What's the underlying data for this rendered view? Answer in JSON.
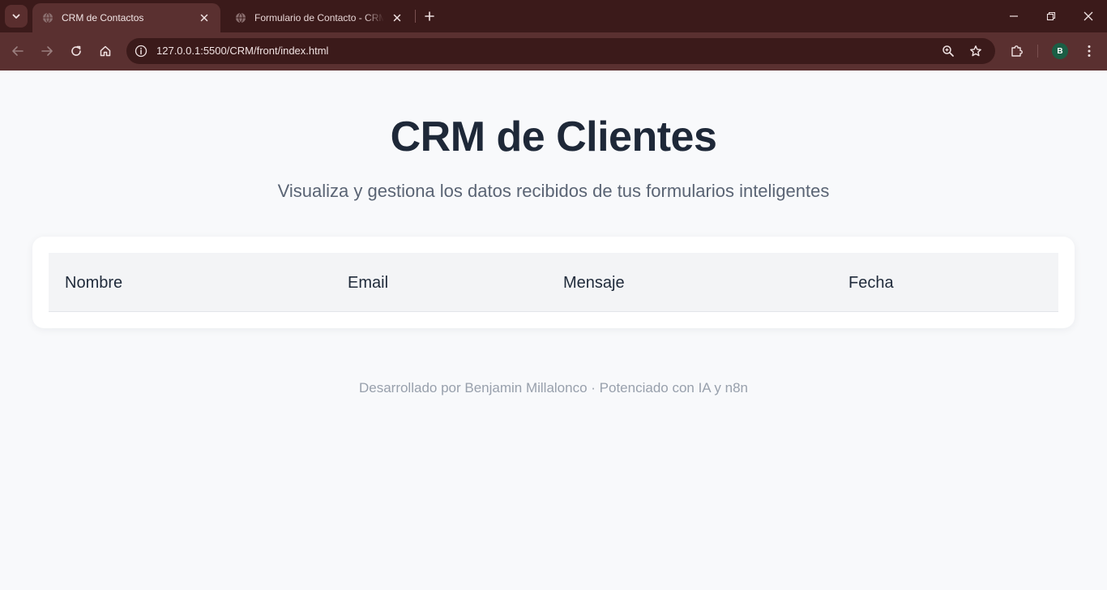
{
  "browser": {
    "tabs": [
      {
        "title": "CRM de Contactos",
        "active": true
      },
      {
        "title": "Formulario de Contacto - CRM",
        "active": false
      }
    ],
    "url": "127.0.0.1:5500/CRM/front/index.html",
    "profile_initial": "B",
    "colors": {
      "frame": "#3b1a1a",
      "toolbar": "#5a3030",
      "profile": "#1b5e45"
    }
  },
  "page": {
    "title": "CRM de Clientes",
    "subtitle": "Visualiza y gestiona los datos recibidos de tus formularios inteligentes",
    "table": {
      "headers": [
        "Nombre",
        "Email",
        "Mensaje",
        "Fecha"
      ],
      "rows": []
    },
    "footer": "Desarrollado por Benjamin Millalonco · Potenciado con IA y n8n"
  }
}
